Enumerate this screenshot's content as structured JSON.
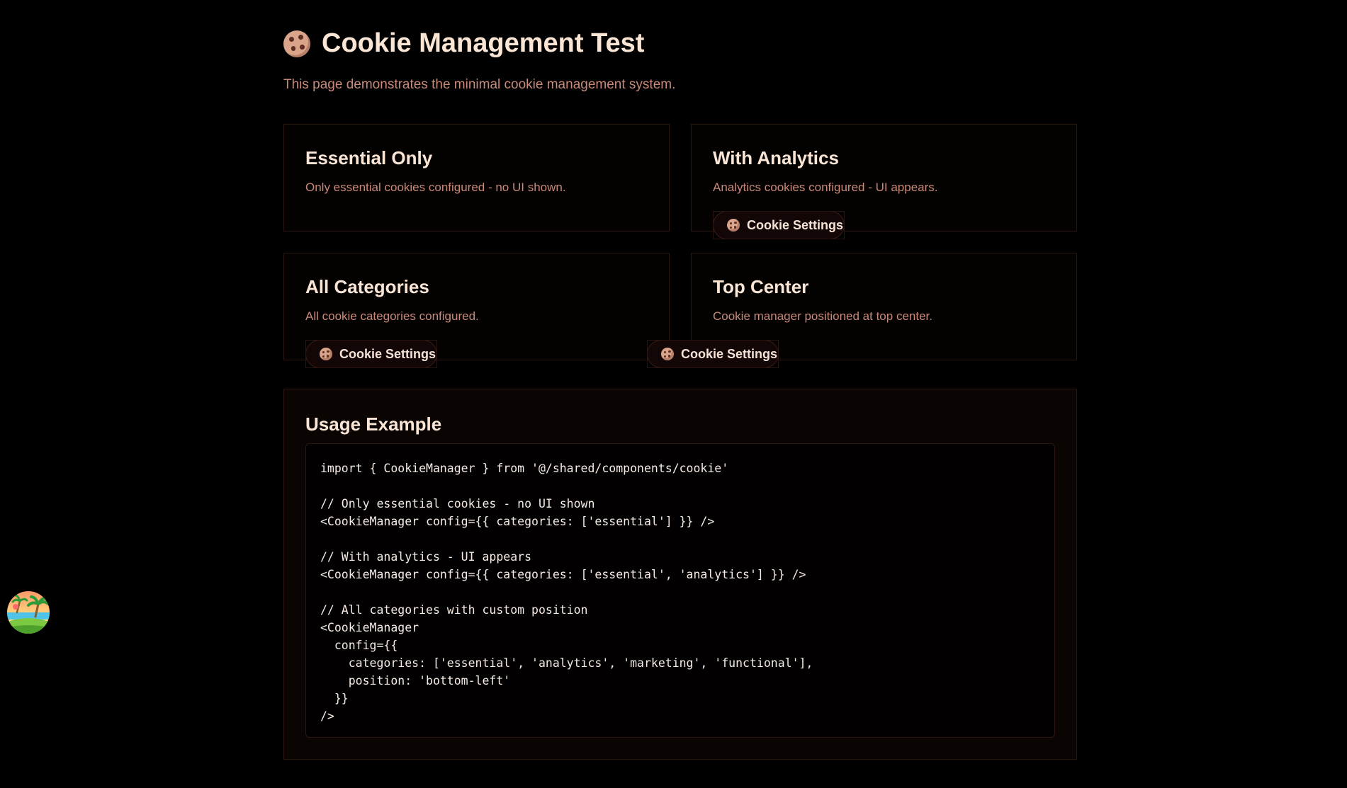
{
  "page": {
    "title": "Cookie Management Test",
    "subtitle": "This page demonstrates the minimal cookie management system."
  },
  "cards": [
    {
      "title": "Essential Only",
      "description": "Only essential cookies configured - no UI shown."
    },
    {
      "title": "With Analytics",
      "description": "Analytics cookies configured - UI appears."
    },
    {
      "title": "All Categories",
      "description": "All cookie categories configured."
    },
    {
      "title": "Top Center",
      "description": "Cookie manager positioned at top center."
    }
  ],
  "cookie_buttons": [
    {
      "label": "Cookie Settings"
    },
    {
      "label": "Cookie Settings"
    },
    {
      "label": "Cookie Settings"
    }
  ],
  "usage": {
    "title": "Usage Example",
    "code": "import { CookieManager } from '@/shared/components/cookie'\n\n// Only essential cookies - no UI shown\n<CookieManager config={{ categories: ['essential'] }} />\n\n// With analytics - UI appears\n<CookieManager config={{ categories: ['essential', 'analytics'] }} />\n\n// All categories with custom position\n<CookieManager\n  config={{\n    categories: ['essential', 'analytics', 'marketing', 'functional'],\n    position: 'bottom-left'\n  }}\n/>"
  },
  "icons": {
    "title_icon": "cookie-icon",
    "button_icon": "cookie-icon",
    "avatar": "beach-avatar-icon"
  },
  "colors": {
    "background": "#000000",
    "heading": "#fbe6d6",
    "muted_text": "#c98a7a",
    "border": "#2b1612"
  }
}
